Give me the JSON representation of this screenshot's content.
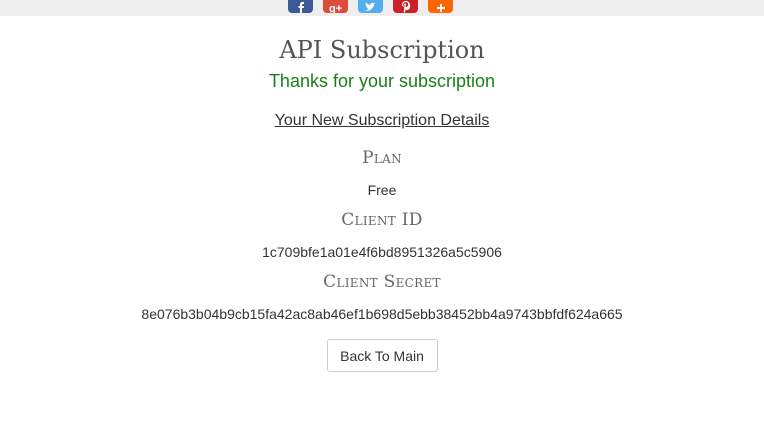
{
  "share": {
    "buttons": [
      {
        "network": "facebook",
        "icon": "facebook-icon",
        "color": "#3b5998"
      },
      {
        "network": "google-plus",
        "icon": "google-plus-icon",
        "color": "#dd4b39"
      },
      {
        "network": "twitter",
        "icon": "twitter-icon",
        "color": "#55acee"
      },
      {
        "network": "pinterest",
        "icon": "pinterest-icon",
        "color": "#cb2027"
      },
      {
        "network": "more",
        "icon": "plus-icon",
        "color": "#ff6600"
      }
    ]
  },
  "page": {
    "title": "API Subscription",
    "thanks": "Thanks for your subscription",
    "details_heading": "Your New Subscription Details"
  },
  "subscription": {
    "plan_label": "Plan",
    "plan_value": "Free",
    "client_id_label": "Client ID",
    "client_id_value": "1c709bfe1a01e4f6bd8951326a5c5906",
    "client_secret_label": "Client Secret",
    "client_secret_value": "8e076b3b04b9cb15fa42ac8ab46ef1b698d5ebb38452bb4a9743bbfdf624a665"
  },
  "actions": {
    "back_label": "Back To Main"
  },
  "colors": {
    "thanks": "#198019",
    "topbar": "#eeeeee"
  }
}
